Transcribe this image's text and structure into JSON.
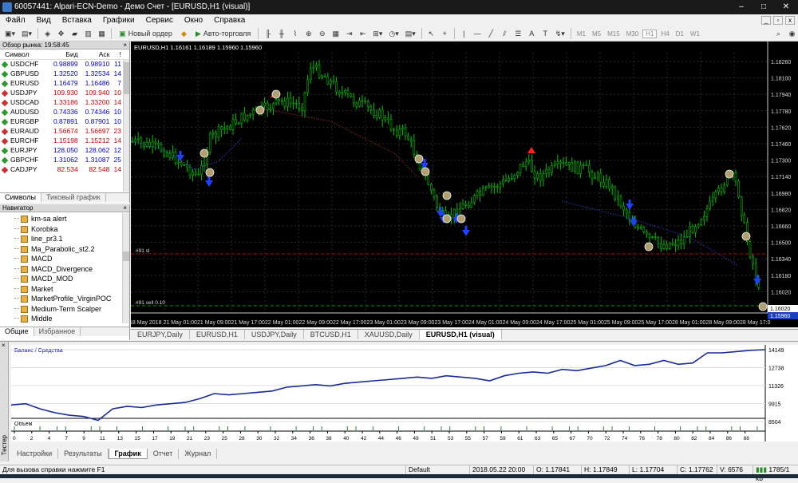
{
  "window": {
    "title": "60057441: Alpari-ECN-Demo - Демо Счет - [EURUSD,H1 (visual)]"
  },
  "menu": [
    "Файл",
    "Вид",
    "Вставка",
    "Графики",
    "Сервис",
    "Окно",
    "Справка"
  ],
  "toolbar": {
    "new_order": "Новый ордер",
    "autotrading": "Авто-торговля",
    "timeframes": [
      "M1",
      "M5",
      "M15",
      "M30",
      "H1",
      "H4",
      "D1",
      "W1"
    ]
  },
  "market_watch": {
    "title": "Обзор рынка: 19:58:45",
    "headers": [
      "Символ",
      "Бид",
      "Аск",
      "!"
    ],
    "rows": [
      {
        "symbol": "USDCHF",
        "bid": "0.98899",
        "ask": "0.98910",
        "spread": "11",
        "dir": "up"
      },
      {
        "symbol": "GBPUSD",
        "bid": "1.32520",
        "ask": "1.32534",
        "spread": "14",
        "dir": "up"
      },
      {
        "symbol": "EURUSD",
        "bid": "1.16479",
        "ask": "1.16486",
        "spread": "7",
        "dir": "up"
      },
      {
        "symbol": "USDJPY",
        "bid": "109.930",
        "ask": "109.940",
        "spread": "10",
        "dir": "dn"
      },
      {
        "symbol": "USDCAD",
        "bid": "1.33186",
        "ask": "1.33200",
        "spread": "14",
        "dir": "dn"
      },
      {
        "symbol": "AUDUSD",
        "bid": "0.74336",
        "ask": "0.74346",
        "spread": "10",
        "dir": "up"
      },
      {
        "symbol": "EURGBP",
        "bid": "0.87891",
        "ask": "0.87901",
        "spread": "10",
        "dir": "up"
      },
      {
        "symbol": "EURAUD",
        "bid": "1.56674",
        "ask": "1.56697",
        "spread": "23",
        "dir": "dn"
      },
      {
        "symbol": "EURCHF",
        "bid": "1.15198",
        "ask": "1.15212",
        "spread": "14",
        "dir": "dn"
      },
      {
        "symbol": "EURJPY",
        "bid": "128.050",
        "ask": "128.062",
        "spread": "12",
        "dir": "up"
      },
      {
        "symbol": "GBPCHF",
        "bid": "1.31062",
        "ask": "1.31087",
        "spread": "25",
        "dir": "up"
      },
      {
        "symbol": "CADJPY",
        "bid": "82.534",
        "ask": "82.548",
        "spread": "14",
        "dir": "dn"
      }
    ],
    "tabs": [
      "Символы",
      "Тиковый график"
    ]
  },
  "navigator": {
    "title": "Навигатор",
    "items": [
      "km-sa alert",
      "Korobka",
      "line_pr3.1",
      "Ma_Parabolic_st2.2",
      "MACD",
      "MACD_Divergence",
      "MACD_MOD",
      "Market",
      "MarketProfile_VirginPOC",
      "Medium-Term Scalper",
      "Middle"
    ],
    "tabs": [
      "Общие",
      "Избранное"
    ]
  },
  "chart": {
    "title": "EURUSD,H1  1.16161 1.16189 1.15960 1.15960",
    "price_labels": [
      "1.18260",
      "1.18100",
      "1.17940",
      "1.17780",
      "1.17620",
      "1.17460",
      "1.17300",
      "1.17140",
      "1.16980",
      "1.16820",
      "1.16660",
      "1.16500",
      "1.16340",
      "1.16180",
      "1.16020"
    ],
    "time_labels": [
      "18 May 2018",
      "21 May 01:00",
      "21 May 09:00",
      "21 May 17:00",
      "22 May 01:00",
      "22 May 09:00",
      "22 May 17:00",
      "23 May 01:00",
      "23 May 09:00",
      "23 May 17:00",
      "24 May 01:00",
      "24 May 09:00",
      "24 May 17:00",
      "25 May 01:00",
      "25 May 09:00",
      "25 May 17:00",
      "28 May 01:00",
      "28 May 09:00",
      "28 May 17:0"
    ],
    "level_labels": [
      "#91 sl",
      "#91 sell 0.10"
    ],
    "current_prices": [
      "1.16020",
      "1.15960"
    ],
    "colors": {
      "bull": "#00c000",
      "bear": "#00c000",
      "up_arrow": "#ff2020",
      "down_arrow": "#2040ff",
      "sl_line": "#c00000",
      "order_line": "#00a000"
    }
  },
  "chart_tabs": [
    "EURJPY,Daily",
    "EURUSD,H1",
    "USDJPY,Daily",
    "BTCUSD,H1",
    "XAUUSD,Daily",
    "EURUSD,H1 (visual)"
  ],
  "tester": {
    "side_label": "Тестер",
    "legend": "Баланс / Средства",
    "volume_label": "Объем",
    "y_labels": [
      "14149",
      "12738",
      "11326",
      "9915",
      "8504"
    ],
    "x_labels": [
      "0",
      "2",
      "4",
      "7",
      "9",
      "11",
      "13",
      "15",
      "17",
      "19",
      "21",
      "23",
      "25",
      "28",
      "30",
      "32",
      "34",
      "36",
      "38",
      "40",
      "42",
      "44",
      "46",
      "49",
      "51",
      "53",
      "55",
      "57",
      "59",
      "61",
      "63",
      "65",
      "67",
      "70",
      "72",
      "74",
      "76",
      "78",
      "80",
      "82",
      "84",
      "86",
      "88"
    ],
    "tabs": [
      "Настройки",
      "Результаты",
      "График",
      "Отчет",
      "Журнал"
    ]
  },
  "status": {
    "help": "Для вызова справки нажмите F1",
    "profile": "Default",
    "datetime": "2018.05.22 20:00",
    "open": "O: 1.17841",
    "high": "H: 1.17849",
    "low": "L: 1.17704",
    "close": "C: 1.17762",
    "volume": "V: 6576",
    "traffic": "1785/1 kb"
  }
}
